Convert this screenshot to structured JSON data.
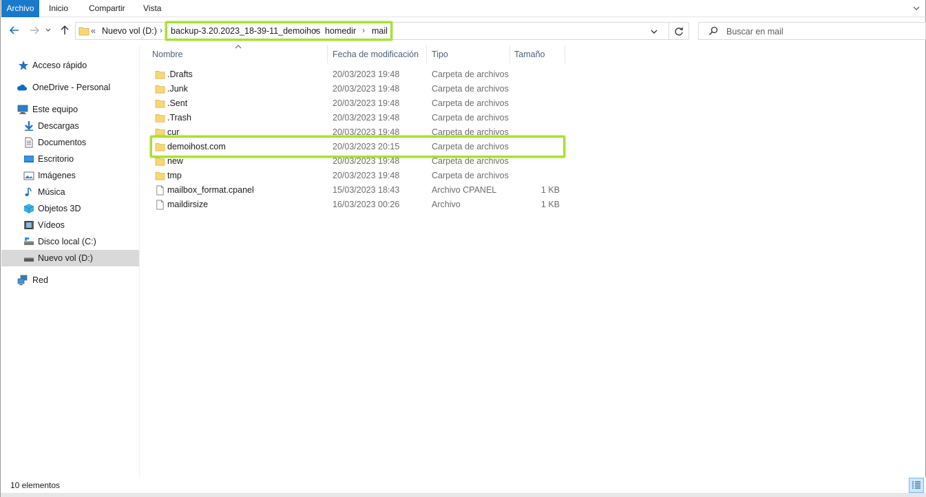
{
  "ribbon": {
    "tabs": [
      "Archivo",
      "Inicio",
      "Compartir",
      "Vista"
    ]
  },
  "address": {
    "overflow": "«",
    "crumbs": [
      "Nuevo vol (D:)",
      "backup-3.20.2023_18-39-11_demoihos",
      "homedir",
      "mail"
    ]
  },
  "search": {
    "placeholder": "Buscar en mail"
  },
  "sidebar": {
    "items": [
      {
        "label": "Acceso rápido",
        "icon": "star-icon"
      },
      {
        "label": "OneDrive - Personal",
        "icon": "cloud-icon"
      },
      {
        "label": "Este equipo",
        "icon": "computer-icon"
      },
      {
        "label": "Descargas",
        "icon": "download-icon"
      },
      {
        "label": "Documentos",
        "icon": "document-icon"
      },
      {
        "label": "Escritorio",
        "icon": "desktop-icon"
      },
      {
        "label": "Imágenes",
        "icon": "image-icon"
      },
      {
        "label": "Música",
        "icon": "music-icon"
      },
      {
        "label": "Objetos 3D",
        "icon": "cube-icon"
      },
      {
        "label": "Vídeos",
        "icon": "video-icon"
      },
      {
        "label": "Disco local (C:)",
        "icon": "drive-icon"
      },
      {
        "label": "Nuevo vol (D:)",
        "icon": "drive-icon"
      },
      {
        "label": "Red",
        "icon": "network-icon"
      }
    ]
  },
  "columns": {
    "name": "Nombre",
    "date": "Fecha de modificación",
    "type": "Tipo",
    "size": "Tamaño"
  },
  "files": [
    {
      "name": ".Drafts",
      "date": "20/03/2023 19:48",
      "type": "Carpeta de archivos",
      "size": "",
      "kind": "folder"
    },
    {
      "name": ".Junk",
      "date": "20/03/2023 19:48",
      "type": "Carpeta de archivos",
      "size": "",
      "kind": "folder"
    },
    {
      "name": ".Sent",
      "date": "20/03/2023 19:48",
      "type": "Carpeta de archivos",
      "size": "",
      "kind": "folder"
    },
    {
      "name": ".Trash",
      "date": "20/03/2023 19:48",
      "type": "Carpeta de archivos",
      "size": "",
      "kind": "folder"
    },
    {
      "name": "cur",
      "date": "20/03/2023 19:48",
      "type": "Carpeta de archivos",
      "size": "",
      "kind": "folder"
    },
    {
      "name": "demoihost.com",
      "date": "20/03/2023 20:15",
      "type": "Carpeta de archivos",
      "size": "",
      "kind": "folder"
    },
    {
      "name": "new",
      "date": "20/03/2023 19:48",
      "type": "Carpeta de archivos",
      "size": "",
      "kind": "folder"
    },
    {
      "name": "tmp",
      "date": "20/03/2023 19:48",
      "type": "Carpeta de archivos",
      "size": "",
      "kind": "folder"
    },
    {
      "name": "mailbox_format.cpanel",
      "date": "15/03/2023 18:43",
      "type": "Archivo CPANEL",
      "size": "1 KB",
      "kind": "file"
    },
    {
      "name": "maildirsize",
      "date": "16/03/2023 00:26",
      "type": "Archivo",
      "size": "1 KB",
      "kind": "file"
    }
  ],
  "status": {
    "count": "10 elementos"
  },
  "colors": {
    "accent": "#1979ca",
    "highlight": "#a6e22e",
    "folder": "#f8d775"
  }
}
